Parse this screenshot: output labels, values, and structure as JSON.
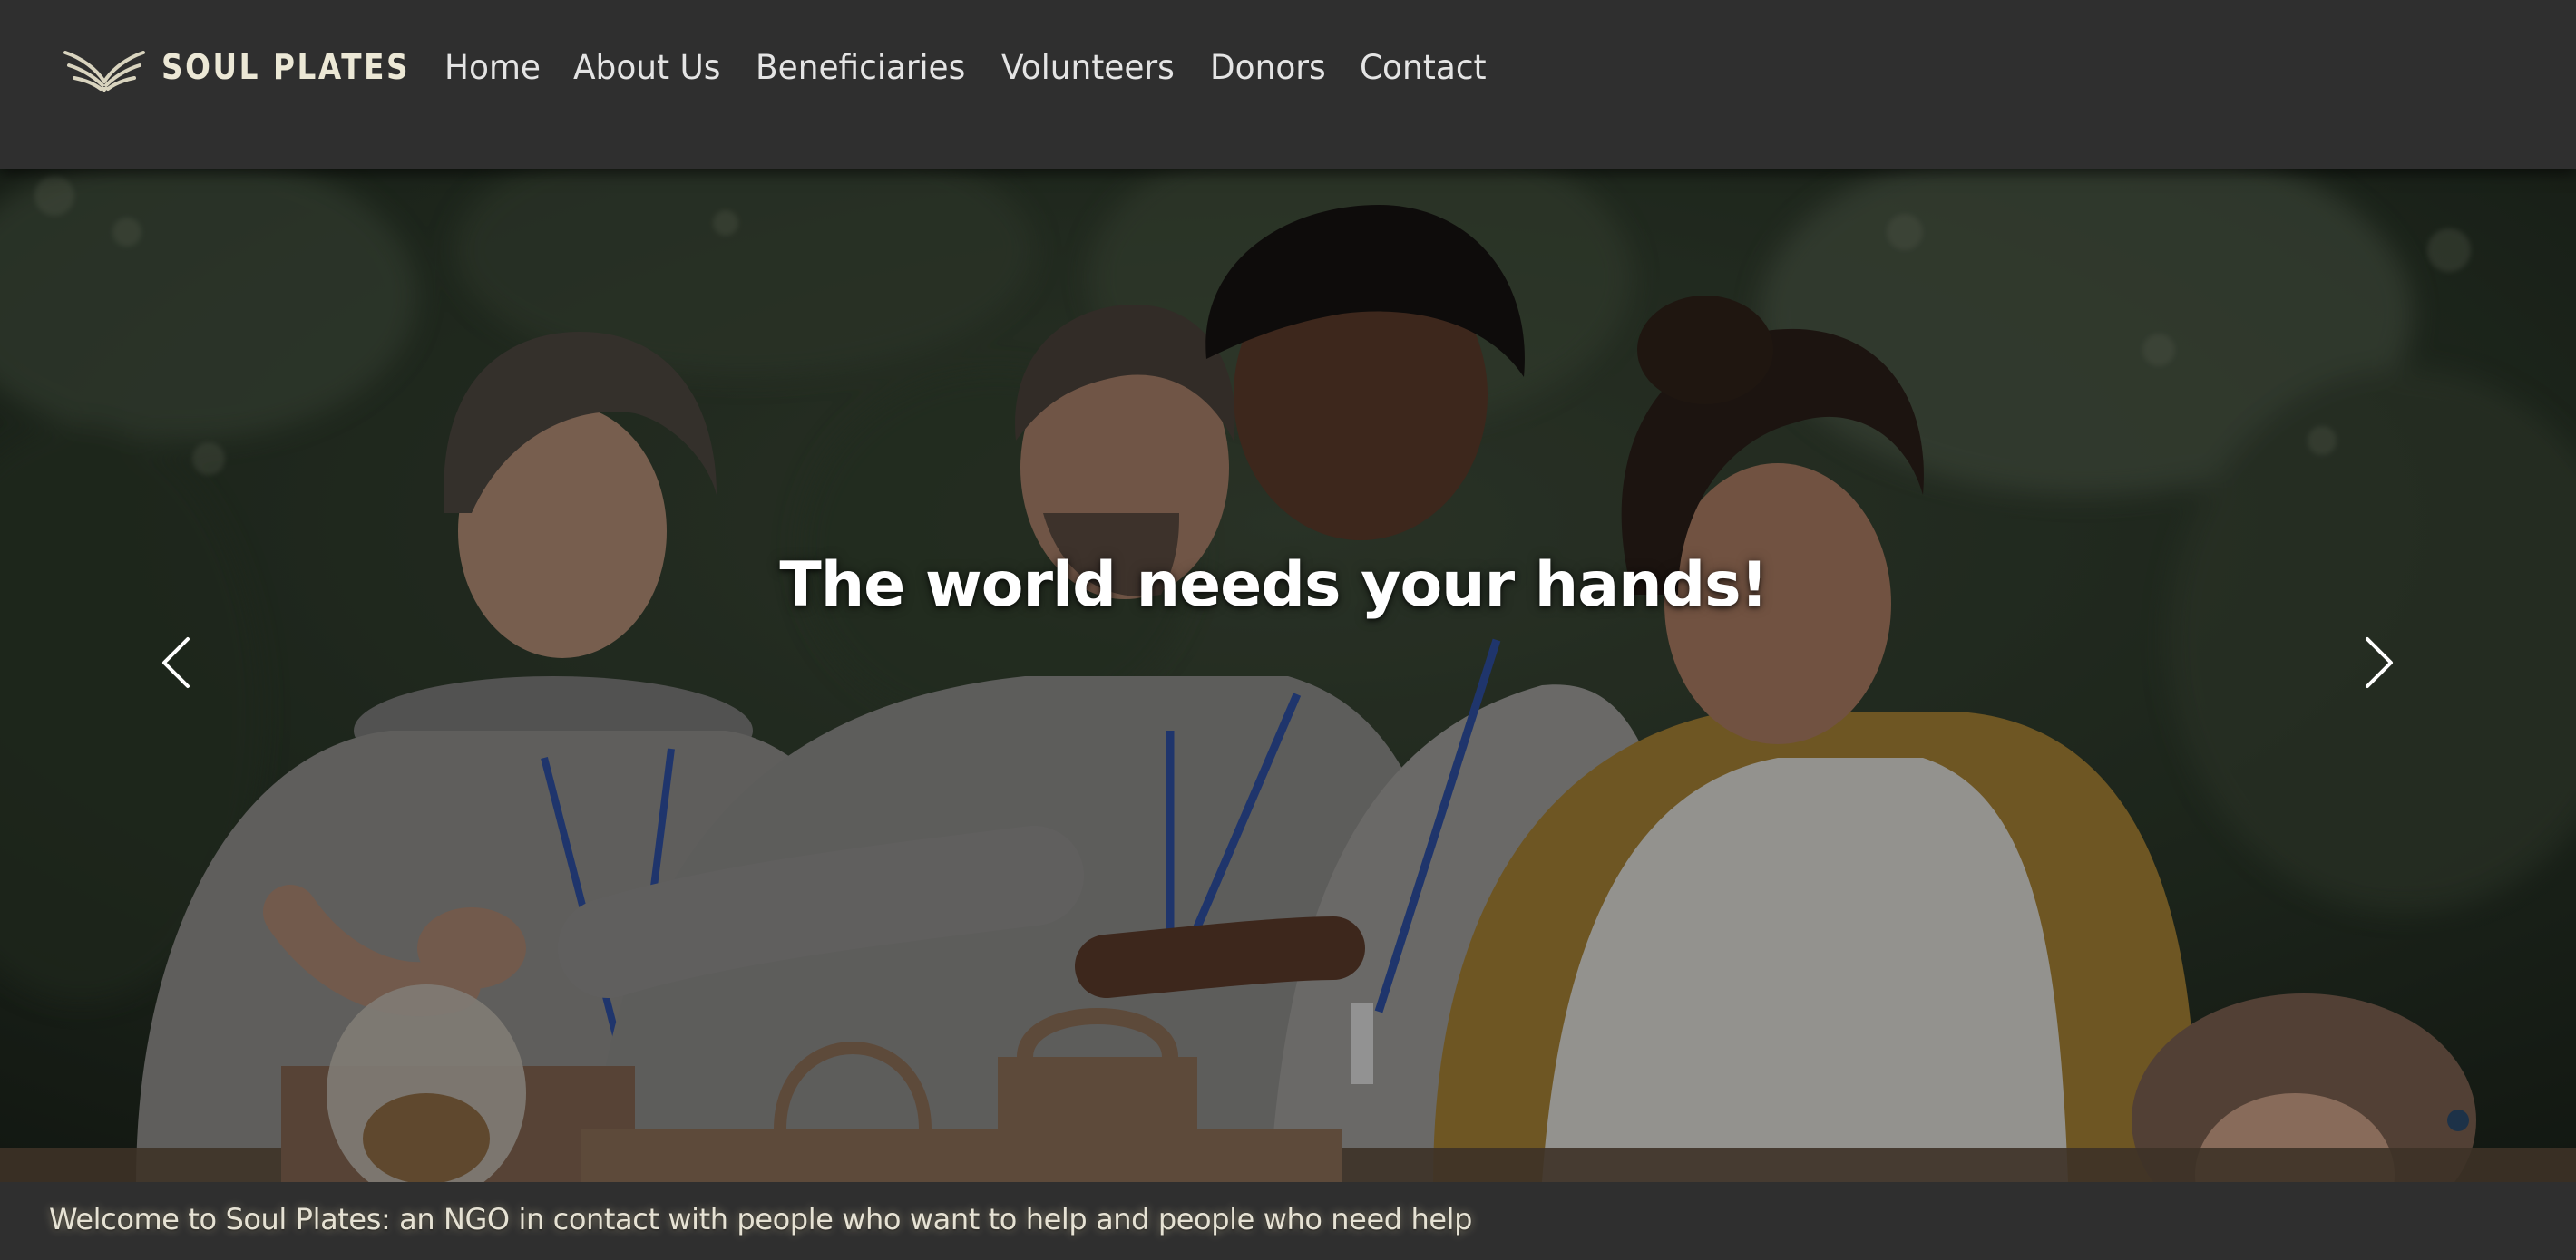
{
  "brand": {
    "name": "SOUL PLATES",
    "logo_icon": "wings-icon",
    "color": "#ece8d6"
  },
  "nav": {
    "items": [
      {
        "label": "Home"
      },
      {
        "label": "About Us"
      },
      {
        "label": "Beneficiaries"
      },
      {
        "label": "Volunteers"
      },
      {
        "label": "Donors"
      },
      {
        "label": "Contact"
      }
    ]
  },
  "hero": {
    "caption": "The world needs your hands!",
    "image_icon": "volunteers-photo",
    "prev_icon": "chevron-left-icon",
    "next_icon": "chevron-right-icon"
  },
  "footer": {
    "welcome": "Welcome to Soul Plates: an NGO in contact with people who want to help and people who need help"
  },
  "colors": {
    "navbar_bg": "#2f2f2f",
    "text": "#e4e4e4",
    "caption": "#ffffff"
  }
}
